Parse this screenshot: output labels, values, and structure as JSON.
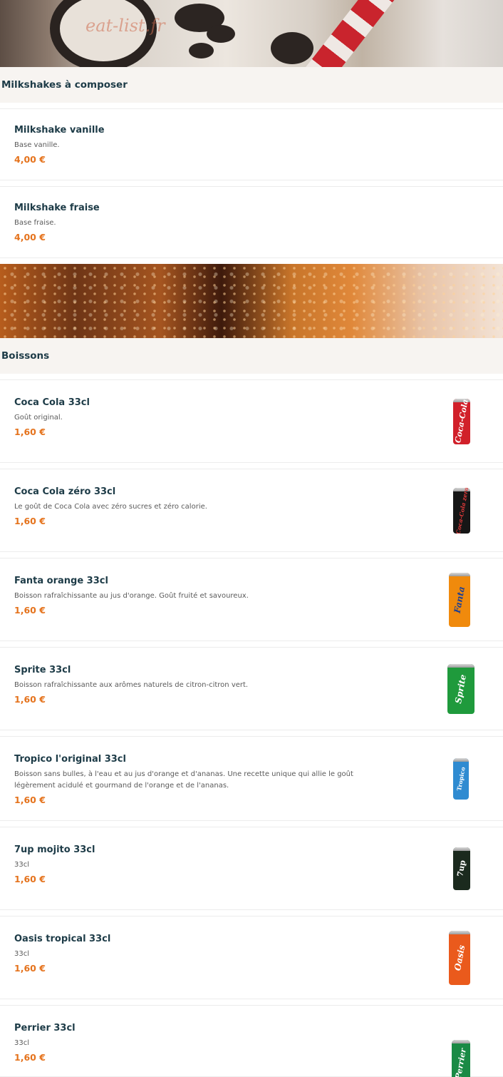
{
  "hero_top": {
    "watermark": "eat-list.fr"
  },
  "sections": {
    "milkshakes": {
      "title": "Milkshakes à composer",
      "items": [
        {
          "name": "Milkshake vanille",
          "description": "Base vanille.",
          "price": "4,00 €"
        },
        {
          "name": "Milkshake fraise",
          "description": "Base fraise.",
          "price": "4,00 €"
        }
      ]
    },
    "boissons": {
      "title": "Boissons",
      "items": [
        {
          "name": "Coca Cola 33cl",
          "description": "Goût original.",
          "price": "1,60 €",
          "image": {
            "icon": "coca-cola-can-icon",
            "brand": "Coca-Cola",
            "color": "#d1202a"
          }
        },
        {
          "name": "Coca Cola zéro 33cl",
          "description": "Le goût de Coca Cola avec zéro sucres et zéro calorie.",
          "price": "1,60 €",
          "image": {
            "icon": "coca-cola-zero-can-icon",
            "brand": "Coca-Cola zero",
            "color": "#161616"
          }
        },
        {
          "name": "Fanta orange 33cl",
          "description": "Boisson rafraîchissante au jus d'orange. Goût fruité et savoureux.",
          "price": "1,60 €",
          "image": {
            "icon": "fanta-can-icon",
            "brand": "Fanta",
            "color": "#f08a0c"
          }
        },
        {
          "name": "Sprite 33cl",
          "description": "Boisson rafraîchissante aux arômes naturels de citron-citron vert.",
          "price": "1,60 €",
          "image": {
            "icon": "sprite-can-icon",
            "brand": "Sprite",
            "color": "#1f9a3c"
          }
        },
        {
          "name": "Tropico l'original 33cl",
          "description": "Boisson sans bulles, à l'eau et au jus d'orange et d'ananas. Une recette unique qui allie le goût légèrement acidulé et gourmand de l'orange et de l'ananas.",
          "price": "1,60 €",
          "image": {
            "icon": "tropico-can-icon",
            "brand": "Tropico",
            "color": "#2f8bd1"
          }
        },
        {
          "name": "7up mojito 33cl",
          "description": "33cl",
          "price": "1,60 €",
          "image": {
            "icon": "7up-mojito-can-icon",
            "brand": "7up",
            "color": "#1b2a1e"
          }
        },
        {
          "name": "Oasis tropical 33cl",
          "description": "33cl",
          "price": "1,60 €",
          "image": {
            "icon": "oasis-can-icon",
            "brand": "Oasis",
            "color": "#ea5a1c"
          }
        },
        {
          "name": "Perrier 33cl",
          "description": "33cl",
          "price": "1,60 €",
          "image": {
            "icon": "perrier-can-icon",
            "brand": "Perrier",
            "color": "#1a8a45"
          }
        }
      ]
    }
  },
  "colors": {
    "price": "#e5731d",
    "heading": "#1d3b47",
    "section_bg": "#f7f4f1"
  }
}
